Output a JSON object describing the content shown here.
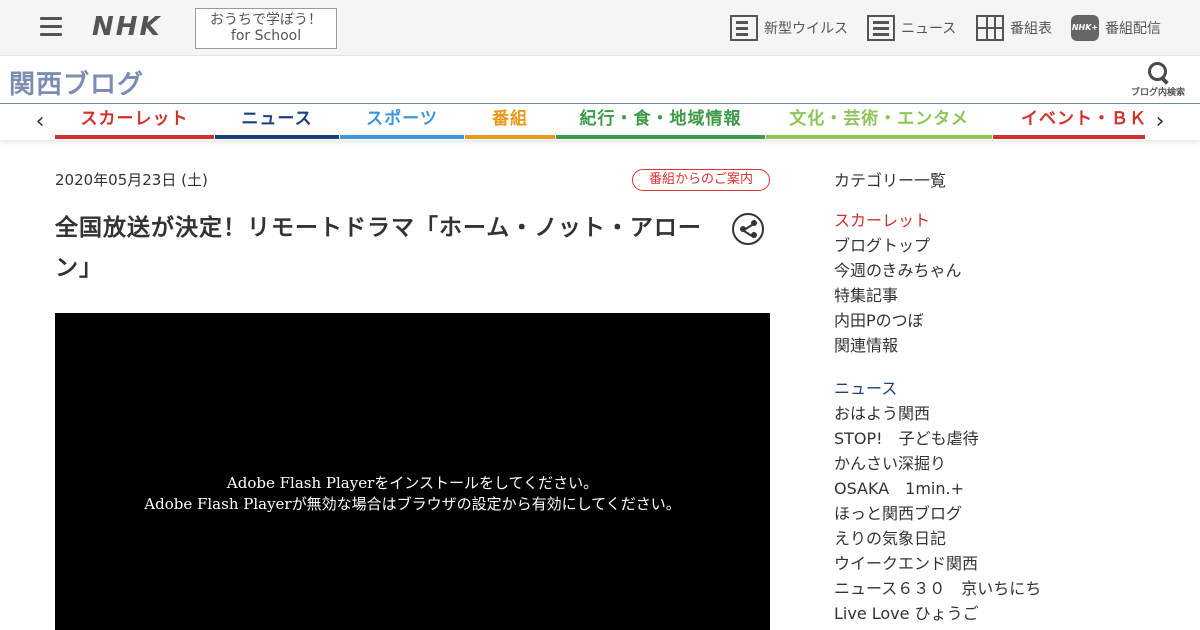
{
  "header": {
    "logo": "NHK",
    "school_line1": "おうちで学ぼう！",
    "school_line2": "for School",
    "nav": [
      {
        "label": "新型ウイルス",
        "icon": "virus-info-icon"
      },
      {
        "label": "ニュース",
        "icon": "news-icon"
      },
      {
        "label": "番組表",
        "icon": "program-table-icon"
      },
      {
        "label": "番組配信",
        "icon": "nhk-plus-icon",
        "icon_text": "NHK+"
      }
    ]
  },
  "blog": {
    "title": "関西ブログ",
    "search_label": "ブログ内検索"
  },
  "tabs": [
    {
      "label": "スカーレット",
      "color": "#d0312d"
    },
    {
      "label": "ニュース",
      "color": "#1c3f7e"
    },
    {
      "label": "スポーツ",
      "color": "#3d97dc"
    },
    {
      "label": "番組",
      "color": "#e99a1b"
    },
    {
      "label": "紀行・食・地域情報",
      "color": "#3f9a49"
    },
    {
      "label": "文化・芸術・エンタメ",
      "color": "#8cc55a"
    },
    {
      "label": "イベント・ＢＫプラザ",
      "color": "#d0312d"
    }
  ],
  "article": {
    "date": "2020年05月23日 (土)",
    "category_badge": "番組からのご案内",
    "title": "全国放送が決定！リモートドラマ「ホーム・ノット・アローン」",
    "video_msg_line1": "Adobe Flash Playerをインストールをしてください。",
    "video_msg_line2": "Adobe Flash Playerが無効な場合はブラウザの設定から有効にしてください。"
  },
  "sidebar": {
    "heading": "カテゴリー一覧",
    "groups": [
      {
        "category": "スカーレット",
        "color": "#d0312d",
        "items": [
          "ブログトップ",
          "今週のきみちゃん",
          "特集記事",
          "内田Pのつぼ",
          "関連情報"
        ]
      },
      {
        "category": "ニュース",
        "color": "#1c3f7e",
        "items": [
          "おはよう関西",
          "STOP!　子ども虐待",
          "かんさい深掘り",
          "OSAKA　1min.+",
          "ほっと関西ブログ",
          "えりの気象日記",
          "ウイークエンド関西",
          "ニュース６３０　京いちにち",
          "Live Love ひょうご"
        ]
      }
    ]
  }
}
